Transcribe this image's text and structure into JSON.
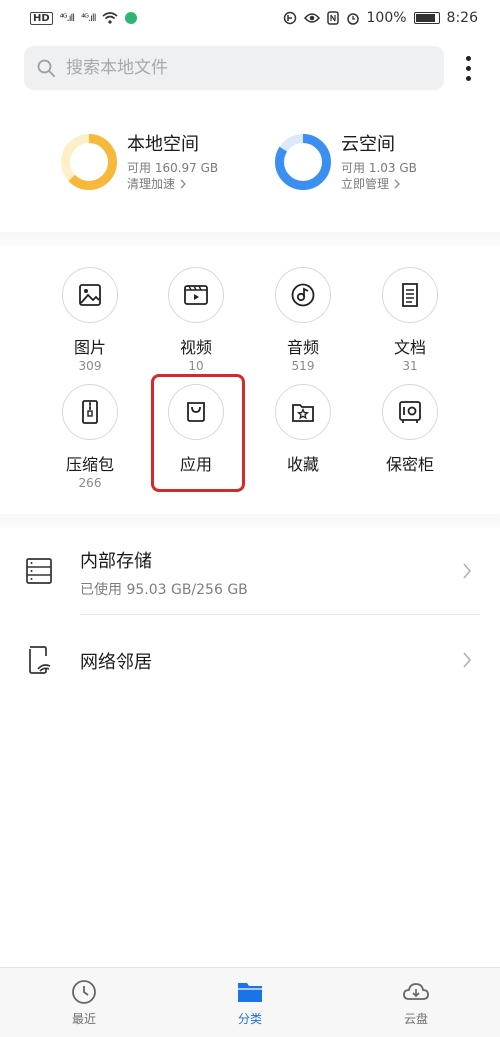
{
  "status_bar": {
    "hd": "HD",
    "signal1": "⁴ᴳ.ıll",
    "signal2": "⁴ᴳ.ıll",
    "battery": "100%",
    "time": "8:26"
  },
  "search": {
    "placeholder": "搜索本地文件"
  },
  "storage": {
    "local": {
      "title": "本地空间",
      "available": "可用 160.97 GB",
      "action": "清理加速",
      "used_fraction": 0.63,
      "color": "#f6b93b",
      "track": "#fdf0c8"
    },
    "cloud": {
      "title": "云空间",
      "available": "可用 1.03 GB",
      "action": "立即管理",
      "used_fraction": 0.84,
      "color": "#3b8ff0",
      "track": "#dbe9fb"
    }
  },
  "categories": [
    {
      "label": "图片",
      "count": "309",
      "icon": "image-icon"
    },
    {
      "label": "视频",
      "count": "10",
      "icon": "video-icon"
    },
    {
      "label": "音频",
      "count": "519",
      "icon": "audio-icon"
    },
    {
      "label": "文档",
      "count": "31",
      "icon": "document-icon"
    },
    {
      "label": "压缩包",
      "count": "266",
      "icon": "archive-icon"
    },
    {
      "label": "应用",
      "count": "",
      "icon": "app-bag-icon"
    },
    {
      "label": "收藏",
      "count": "",
      "icon": "favorites-icon"
    },
    {
      "label": "保密柜",
      "count": "",
      "icon": "safe-icon"
    }
  ],
  "locations": [
    {
      "title": "内部存储",
      "subtitle": "已使用 95.03 GB/256 GB",
      "icon": "internal-storage-icon"
    },
    {
      "title": "网络邻居",
      "subtitle": "",
      "icon": "network-neighbor-icon"
    }
  ],
  "bottom_nav": [
    {
      "label": "最近",
      "icon": "clock-icon",
      "active": false
    },
    {
      "label": "分类",
      "icon": "folder-icon",
      "active": true
    },
    {
      "label": "云盘",
      "icon": "cloud-icon",
      "active": false
    }
  ],
  "colors": {
    "accent": "#1a73e8",
    "highlight": "#d42a2a"
  }
}
